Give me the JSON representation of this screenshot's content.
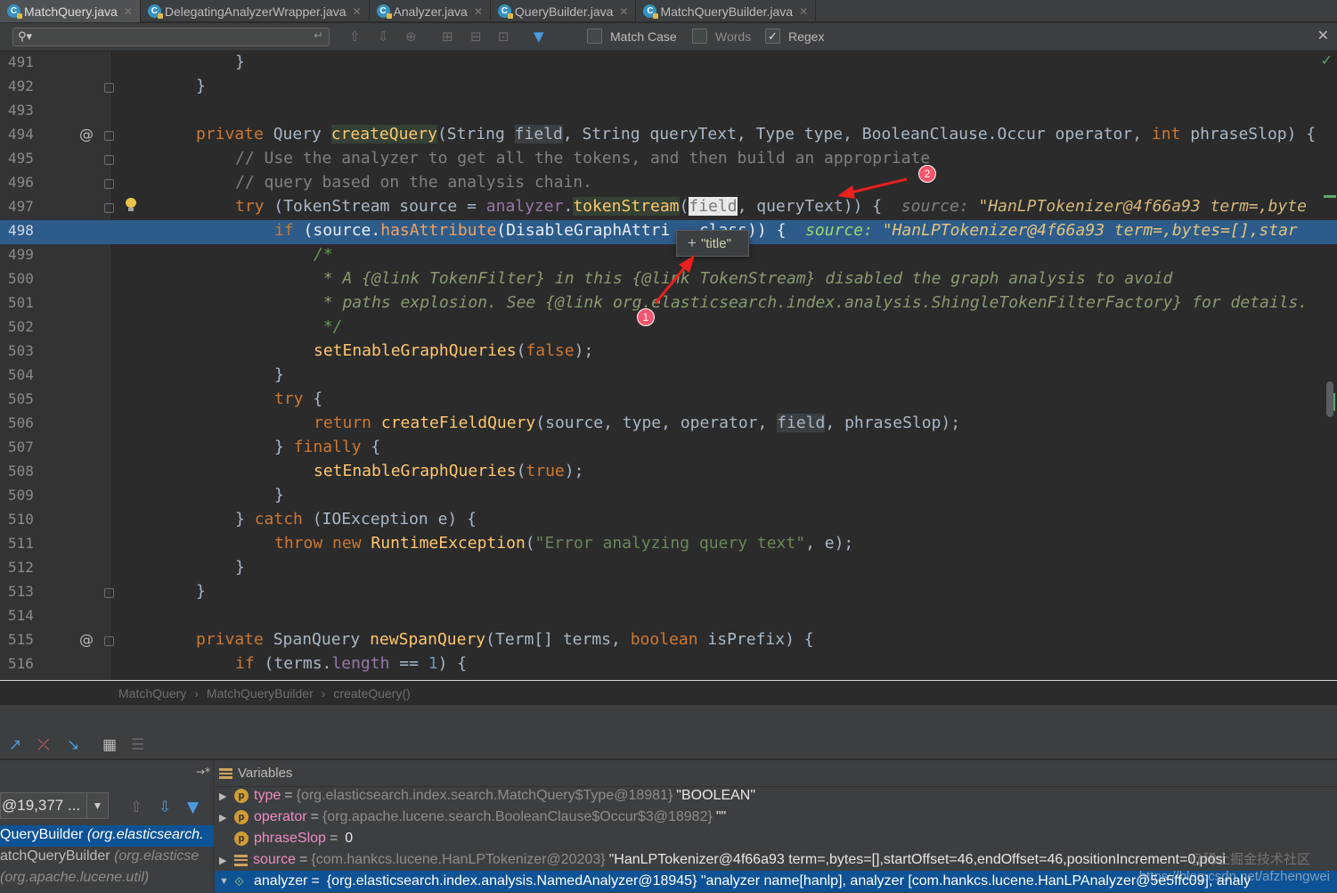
{
  "tabs": [
    {
      "label": "MatchQuery.java",
      "active": true
    },
    {
      "label": "DelegatingAnalyzerWrapper.java"
    },
    {
      "label": "Analyzer.java"
    },
    {
      "label": "QueryBuilder.java"
    },
    {
      "label": "MatchQueryBuilder.java"
    }
  ],
  "search": {
    "value": "",
    "match_case": "Match Case",
    "words": "Words",
    "regex": "Regex",
    "check_glyph": "✓",
    "close_glyph": "✕"
  },
  "editor": {
    "lines": {
      "l491": {
        "num": "491"
      },
      "l492": {
        "num": "492"
      },
      "l493": {
        "num": "493"
      },
      "l494": {
        "num": "494"
      },
      "l495": {
        "num": "495"
      },
      "l496": {
        "num": "496"
      },
      "l497": {
        "num": "497"
      },
      "l498": {
        "num": "498"
      },
      "l499": {
        "num": "499"
      },
      "l500": {
        "num": "500"
      },
      "l501": {
        "num": "501"
      },
      "l502": {
        "num": "502"
      },
      "l503": {
        "num": "503"
      },
      "l504": {
        "num": "504"
      },
      "l505": {
        "num": "505"
      },
      "l506": {
        "num": "506"
      },
      "l507": {
        "num": "507"
      },
      "l508": {
        "num": "508"
      },
      "l509": {
        "num": "509"
      },
      "l510": {
        "num": "510"
      },
      "l511": {
        "num": "511"
      },
      "l512": {
        "num": "512"
      },
      "l513": {
        "num": "513"
      },
      "l514": {
        "num": "514"
      },
      "l515": {
        "num": "515"
      },
      "l516": {
        "num": "516"
      }
    },
    "tok": {
      "brace": "}",
      "open_brace": "{",
      "private": "private",
      "Query": "Query",
      "createQuery": "createQuery",
      "sig_a": "(String ",
      "field": "field",
      "sig_b": ", String queryText, Type type, BooleanClause.Occur operator, ",
      "int": "int",
      "sig_c": " phraseSlop) {",
      "comment1": "// Use the analyzer to get all the tokens, and then build an appropriate",
      "comment2": "// query based on the analysis chain.",
      "try": "try",
      "ts_a": " (TokenStream source = ",
      "analyzer": "analyzer",
      "dot": ".",
      "tokenStream": "tokenStream",
      "paren": "(",
      "ts_b": ", queryText)) {  ",
      "hint_label": "source: ",
      "hint_val497": "\"HanLPTokenizer@4f66a93 term=,byte",
      "if": "if",
      "if_a": " (source.",
      "hasAttribute": "hasAttribute",
      "if_b": "(DisableGraphAttri",
      "if_c": "   class)) {  ",
      "hint_val498": "\"HanLPTokenizer@4f66a93 term=,bytes=[],star",
      "doc_open": "/*",
      "doc1": " * A {@link TokenFilter} in this {@link TokenStream} disabled the graph analysis to avoid",
      "doc2": " * paths explosion. See {@link org.elasticsearch.index.analysis.ShingleTokenFilterFactory} for details.",
      "doc_close": " */",
      "setEnableGraphQueries": "setEnableGraphQueries",
      "false": "false",
      "true": "true",
      "close_paren_semi": ");",
      "try_open": " {",
      "return": "return",
      "createFieldQuery": "createFieldQuery",
      "cfq_a": "(source, type, operator, ",
      "cfq_b": ", phraseSlop);",
      "finally": "finally",
      "catch": "catch",
      "catch_a": " (IOException e) {",
      "throw": "throw",
      "new": "new",
      "RuntimeException": "RuntimeException",
      "err_str": "\"Error analyzing query text\"",
      "err_b": ", e);",
      "SpanQuery": "SpanQuery",
      "newSpanQuery": "newSpanQuery",
      "nsq_a": "(Term[] terms, ",
      "boolean": "boolean",
      "nsq_b": " isPrefix) {",
      "if_terms": " (terms.",
      "length": "length",
      "eqeq": " == ",
      "one": "1",
      "if_end": ") {",
      "at": "@"
    },
    "tooltip": {
      "plus": "+",
      "text": "\"title\""
    },
    "badges": {
      "one": "1",
      "two": "2"
    }
  },
  "breadcrumb": [
    "MatchQuery",
    "MatchQueryBuilder",
    "createQuery()"
  ],
  "debug": {
    "thread_value": "@19,377 ...",
    "frames": [
      {
        "name": "QueryBuilder",
        "pkg": "(org.elasticsearch.",
        "selected": true
      },
      {
        "name": "atchQueryBuilder",
        "pkg": "(org.elasticse"
      },
      {
        "name": "",
        "pkg": "(org.apache.lucene.util)"
      }
    ],
    "variables_title": "Variables",
    "variables": [
      {
        "expand": "▶",
        "icon": "p",
        "name": "type",
        "type": "{org.elasticsearch.index.search.MatchQuery$Type@18981}",
        "value": "\"BOOLEAN\""
      },
      {
        "expand": "▶",
        "icon": "p",
        "name": "operator",
        "type": "{org.apache.lucene.search.BooleanClause$Occur$3@18982}",
        "value": "\"\""
      },
      {
        "expand": "",
        "icon": "p",
        "name": "phraseSlop",
        "type": "",
        "value": "0"
      },
      {
        "expand": "▶",
        "icon": "stack",
        "name": "source",
        "type": "{com.hankcs.lucene.HanLPTokenizer@20203}",
        "value": "\"HanLPTokenizer@4f66a93 term=,bytes=[],startOffset=46,endOffset=46,positionIncrement=0,posi"
      },
      {
        "expand": "▼",
        "icon": "link",
        "name": "analyzer",
        "type": "",
        "value": "{org.elasticsearch.index.analysis.NamedAnalyzer@18945} \"analyzer name[hanlp], analyzer [com.hankcs.lucene.HanLPAnalyzer@5e5ffc09], analy",
        "selected": true
      }
    ],
    "watermark": "https://blog.csdn.net/afzhengwei",
    "watermark2": "@稀土掘金技术社区"
  }
}
